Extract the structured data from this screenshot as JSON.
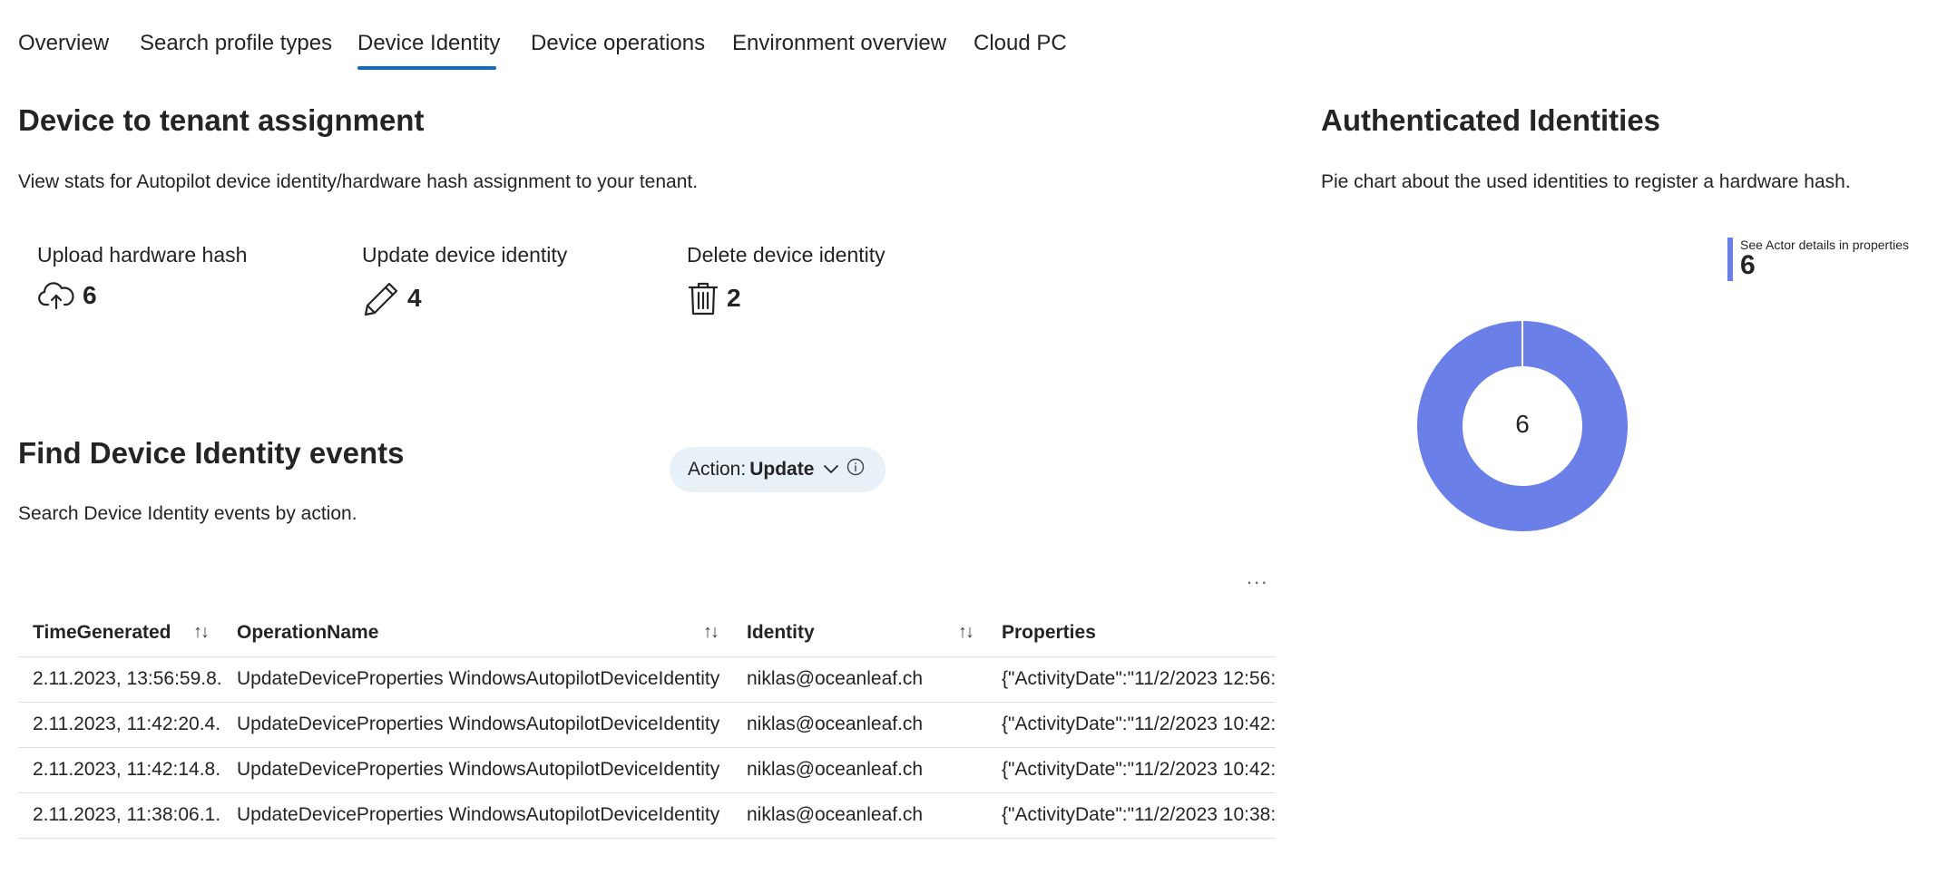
{
  "tabs": [
    {
      "label": "Overview"
    },
    {
      "label": "Search profile types"
    },
    {
      "label": "Device Identity",
      "active": true
    },
    {
      "label": "Device operations"
    },
    {
      "label": "Environment overview"
    },
    {
      "label": "Cloud PC"
    }
  ],
  "tenant_assignment": {
    "title": "Device to tenant assignment",
    "description": "View stats for Autopilot device identity/hardware hash assignment to your tenant.",
    "stats": [
      {
        "label": "Upload hardware hash",
        "value": "6",
        "icon": "cloud-upload-icon"
      },
      {
        "label": "Update device identity",
        "value": "4",
        "icon": "pencil-icon"
      },
      {
        "label": "Delete device identity",
        "value": "2",
        "icon": "trash-icon"
      }
    ]
  },
  "events": {
    "title": "Find Device Identity events",
    "description": "Search Device Identity events by action.",
    "filter": {
      "label": "Action:",
      "value": "Update"
    },
    "more_label": "...",
    "columns": [
      "TimeGenerated",
      "OperationName",
      "Identity",
      "Properties"
    ],
    "rows": [
      [
        "2.11.2023, 13:56:59.8...",
        "UpdateDeviceProperties WindowsAutopilotDeviceIdentity",
        "niklas@oceanleaf.ch",
        "{\"ActivityDate\":\"11/2/2023 12:56:"
      ],
      [
        "2.11.2023, 11:42:20.4...",
        "UpdateDeviceProperties WindowsAutopilotDeviceIdentity",
        "niklas@oceanleaf.ch",
        "{\"ActivityDate\":\"11/2/2023 10:42:"
      ],
      [
        "2.11.2023, 11:42:14.8...",
        "UpdateDeviceProperties WindowsAutopilotDeviceIdentity",
        "niklas@oceanleaf.ch",
        "{\"ActivityDate\":\"11/2/2023 10:42:"
      ],
      [
        "2.11.2023, 11:38:06.1...",
        "UpdateDeviceProperties WindowsAutopilotDeviceIdentity",
        "niklas@oceanleaf.ch",
        "{\"ActivityDate\":\"11/2/2023 10:38:"
      ]
    ]
  },
  "identities": {
    "title": "Authenticated Identities",
    "description": "Pie chart about the used identities to register a hardware hash."
  },
  "chart_data": {
    "type": "pie",
    "donut": true,
    "categories": [
      "See Actor details in properties"
    ],
    "values": [
      6
    ],
    "center_label": "6",
    "legend_position": "top-right",
    "colors": [
      "#6b7fe8"
    ]
  },
  "colors": {
    "accent": "#0f6cbd",
    "series": "#6b7fe8",
    "pill_bg": "#e8f0f8"
  }
}
